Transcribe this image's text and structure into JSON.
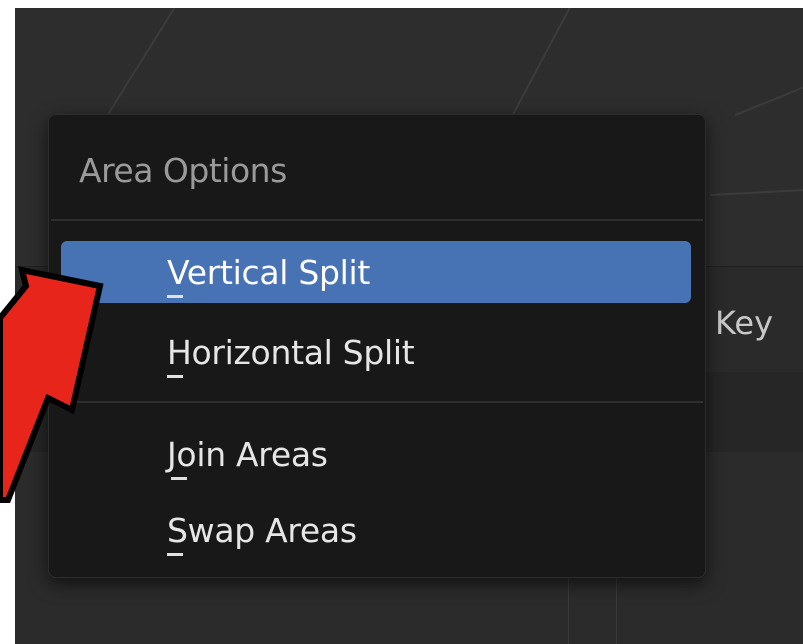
{
  "menu": {
    "title": "Area Options",
    "items": [
      {
        "label": "Vertical Split",
        "active": true
      },
      {
        "label": "Horizontal Split",
        "active": false
      },
      {
        "label": "Join Areas",
        "active": false
      },
      {
        "label": "Swap Areas",
        "active": false
      }
    ]
  },
  "background": {
    "partial_label": "Key"
  },
  "colors": {
    "viewport": "#2d2d2d",
    "menu_bg": "#181818",
    "highlight": "#4772b3",
    "callout_arrow": "#e8251a"
  },
  "icons": {
    "callout": "red-arrow-pointer-icon"
  }
}
